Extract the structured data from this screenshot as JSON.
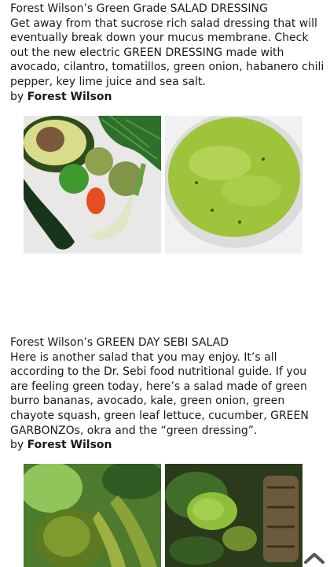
{
  "posts": [
    {
      "title": "Forest Wilson’s Green Grade SALAD DRESSING",
      "body": "Get away from that sucrose rich salad dressing that will eventually break down your mucus membrane. Check out the new electric GREEN DRESSING made with avocado, cilantro, tomatillos, green onion, habanero chili pepper, key lime juice and sea salt.",
      "by_prefix": "by ",
      "author": "Forest Wilson"
    },
    {
      "title": "Forest Wilson’s GREEN DAY SEBI SALAD",
      "body": "Here is another salad that you may enjoy. It’s all according to the Dr. Sebi food nutritional guide. If you are feeling green today, here’s a salad made of green burro bananas, avocado, kale, green onion, green chayote squash, green leaf lettuce, cucumber, GREEN GARBONZOs, okra and the “green dressing”.",
      "by_prefix": "by ",
      "author": "Forest Wilson"
    }
  ],
  "icons": {
    "scroll_top": "chevron-up-icon"
  }
}
